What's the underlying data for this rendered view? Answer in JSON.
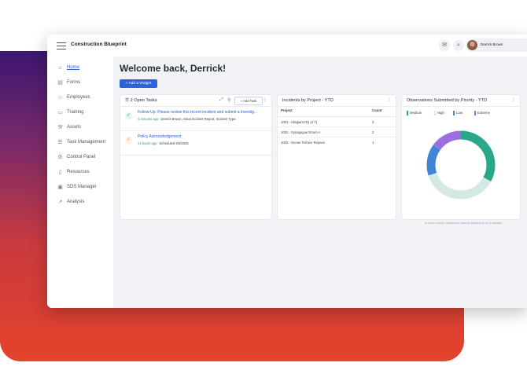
{
  "app": {
    "title": "Construction Blueprint"
  },
  "header": {
    "user_name": "Derrick Brown",
    "mail_icon": "mail-icon",
    "search_icon": "search-icon"
  },
  "sidebar": {
    "items": [
      {
        "label": "Home",
        "icon": "home-icon",
        "active": true
      },
      {
        "label": "Forms",
        "icon": "forms-icon"
      },
      {
        "label": "Employees",
        "icon": "employees-icon"
      },
      {
        "label": "Training",
        "icon": "training-icon"
      },
      {
        "label": "Assets",
        "icon": "assets-icon"
      },
      {
        "label": "Task Management",
        "icon": "task-icon"
      },
      {
        "label": "Control Panel",
        "icon": "control-panel-icon"
      },
      {
        "label": "Resources",
        "icon": "resources-icon"
      },
      {
        "label": "SDS Manager",
        "icon": "folder-icon"
      },
      {
        "label": "Analysis",
        "icon": "chart-icon"
      }
    ]
  },
  "main": {
    "welcome": "Welcome back, Derrick!",
    "add_widget": "+ Add a Widget",
    "tasks": {
      "title": "2 Open Tasks",
      "add_task": "+ Add Task",
      "items": [
        {
          "title": "Follow-Up: Please review this recent incident and submit a investig...",
          "time": "4 minutes ago",
          "meta": "Derrick Brown, Initial Incident Report, Incident Type:",
          "icon": "shield-check-icon"
        },
        {
          "title": "Policy Acknowledgement",
          "time": "14 hours ago",
          "meta": "Scheduled 9/3/2025",
          "icon": "check-icon"
        }
      ]
    },
    "incidents": {
      "title": "Incidents by Project - YTD",
      "col_project": "Project",
      "col_count": "Count",
      "rows": [
        {
          "project": "1001 - Allegiant HQ (4 T)",
          "count": "3"
        },
        {
          "project": "1002 - Synagogue Room A",
          "count": "2"
        },
        {
          "project": "1003 - Ocean Terrace Repave",
          "count": "1"
        }
      ]
    },
    "observations": {
      "title": "Observations Submitted by Priority - YTD"
    },
    "note": "In some cases, dashboard data is delayed up to 5 minutes.",
    "help": "?"
  },
  "chart_data": {
    "type": "pie",
    "title": "Observations Submitted by Priority - YTD",
    "legend_position": "top",
    "series": [
      {
        "name": "Medium",
        "value": 33,
        "color": "#2aa68a"
      },
      {
        "name": "High",
        "value": 37,
        "color": "#d4e8e4"
      },
      {
        "name": "Low",
        "value": 15,
        "color": "#3f86d6"
      },
      {
        "name": "Extreme",
        "value": 15,
        "color": "#9b6fe0"
      }
    ]
  }
}
